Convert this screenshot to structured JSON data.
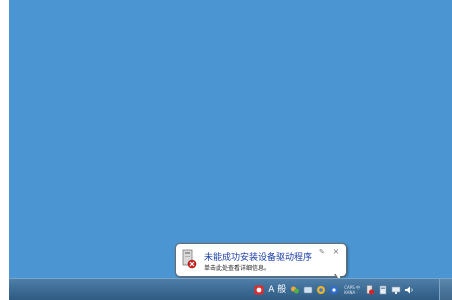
{
  "notification": {
    "title": "未能成功安装设备驱动程序",
    "message": "单击此处查看详细信息。",
    "pin_glyph": "✎",
    "close_glyph": "×"
  },
  "taskbar": {
    "ime_label": "A 般",
    "tray_text_line1": "CAPS 中",
    "tray_text_line2": "KANA ·"
  },
  "colors": {
    "desktop": "#4a95d2",
    "taskbar": "#3e6d96",
    "balloon_title": "#1a3da8"
  },
  "icons": [
    "device-installer-error-icon",
    "pin-icon",
    "close-icon",
    "antivirus-icon",
    "ime-icon",
    "messenger-icon",
    "network-icon",
    "shield-icon",
    "help-icon",
    "device-warning-icon",
    "usb-device-icon",
    "display-icon",
    "volume-icon"
  ]
}
